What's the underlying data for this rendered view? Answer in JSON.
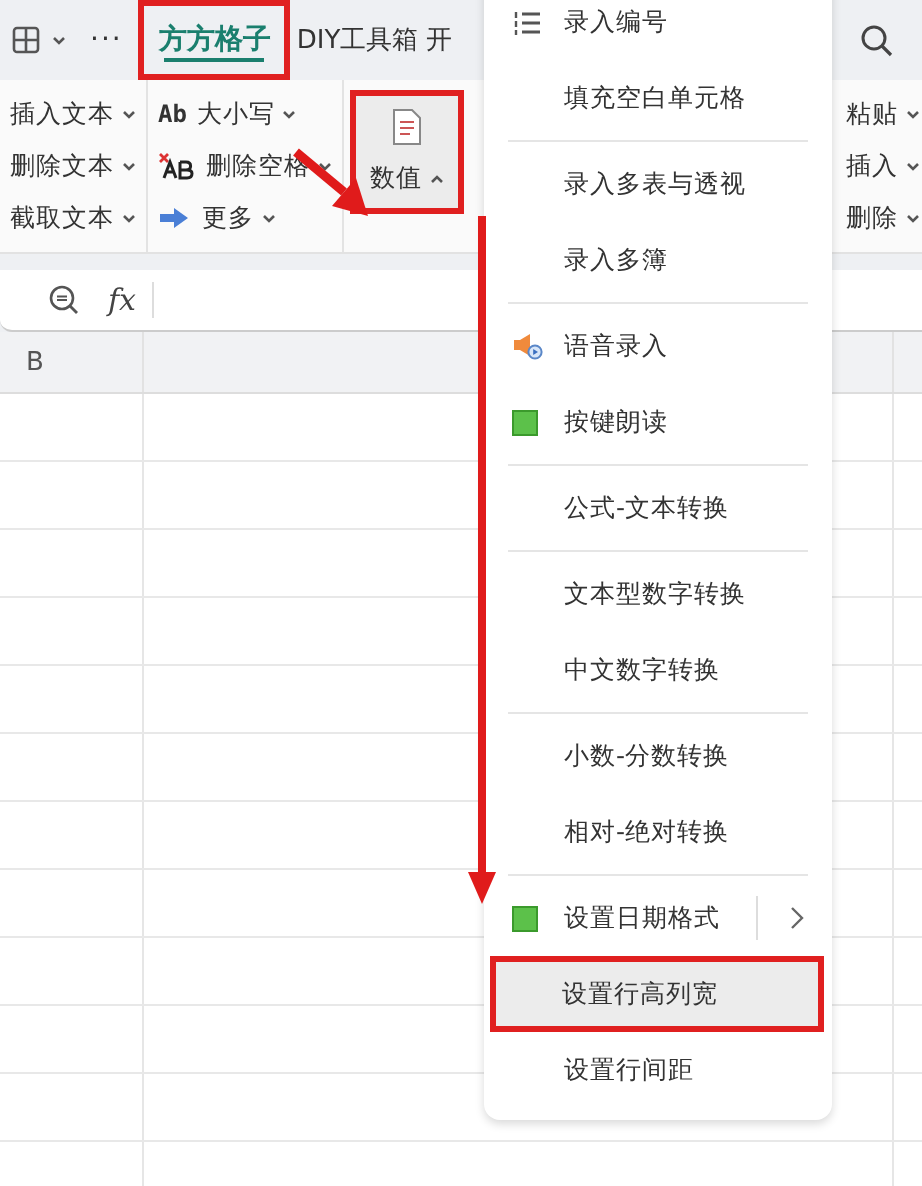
{
  "tabbar": {
    "more": "···",
    "tabs": [
      {
        "label": "方方格子",
        "selected": true,
        "highlighted": true
      },
      {
        "label": "DIY工具箱",
        "selected": false,
        "highlighted": false
      },
      {
        "label": "开",
        "selected": false,
        "highlighted": false
      }
    ]
  },
  "ribbon": {
    "groups": [
      {
        "items": [
          {
            "label": "插入文本",
            "kind": "plain"
          },
          {
            "label": "删除文本",
            "kind": "plain"
          },
          {
            "label": "截取文本",
            "kind": "plain"
          }
        ]
      },
      {
        "items": [
          {
            "label": "大小写",
            "kind": "case",
            "glyph": "Ab"
          },
          {
            "label": "删除空格",
            "kind": "remove-space"
          },
          {
            "label": "更多",
            "kind": "more"
          }
        ]
      }
    ],
    "big_button": {
      "label": "数值",
      "expanded": true,
      "highlighted": true
    },
    "right_items": [
      {
        "label": "粘贴"
      },
      {
        "label": "插入"
      },
      {
        "label": "删除"
      }
    ]
  },
  "formula_bar": {
    "fx": "fx"
  },
  "sheet": {
    "columns": [
      "B"
    ]
  },
  "menu": {
    "items": [
      {
        "label": "录入编号",
        "kind": "numbered-list",
        "separator_after": false,
        "submenu": false,
        "selected": false
      },
      {
        "label": "填充空白单元格",
        "kind": "plain",
        "separator_after": true,
        "submenu": false,
        "selected": false
      },
      {
        "label": "录入多表与透视",
        "kind": "plain",
        "separator_after": false,
        "submenu": false,
        "selected": false
      },
      {
        "label": "录入多簿",
        "kind": "plain",
        "separator_after": true,
        "submenu": false,
        "selected": false
      },
      {
        "label": "语音录入",
        "kind": "speaker",
        "separator_after": false,
        "submenu": false,
        "selected": false
      },
      {
        "label": "按键朗读",
        "kind": "square",
        "separator_after": true,
        "submenu": false,
        "selected": false
      },
      {
        "label": "公式-文本转换",
        "kind": "plain",
        "separator_after": true,
        "submenu": false,
        "selected": false
      },
      {
        "label": "文本型数字转换",
        "kind": "plain",
        "separator_after": false,
        "submenu": false,
        "selected": false
      },
      {
        "label": "中文数字转换",
        "kind": "plain",
        "separator_after": true,
        "submenu": false,
        "selected": false
      },
      {
        "label": "小数-分数转换",
        "kind": "plain",
        "separator_after": false,
        "submenu": false,
        "selected": false
      },
      {
        "label": "相对-绝对转换",
        "kind": "plain",
        "separator_after": true,
        "submenu": false,
        "selected": false
      },
      {
        "label": "设置日期格式",
        "kind": "square",
        "separator_after": false,
        "submenu": true,
        "selected": false
      },
      {
        "label": "设置行高列宽",
        "kind": "plain",
        "separator_after": false,
        "submenu": false,
        "selected": true,
        "highlighted": true
      },
      {
        "label": "设置行间距",
        "kind": "plain",
        "separator_after": false,
        "submenu": false,
        "selected": false
      }
    ]
  }
}
